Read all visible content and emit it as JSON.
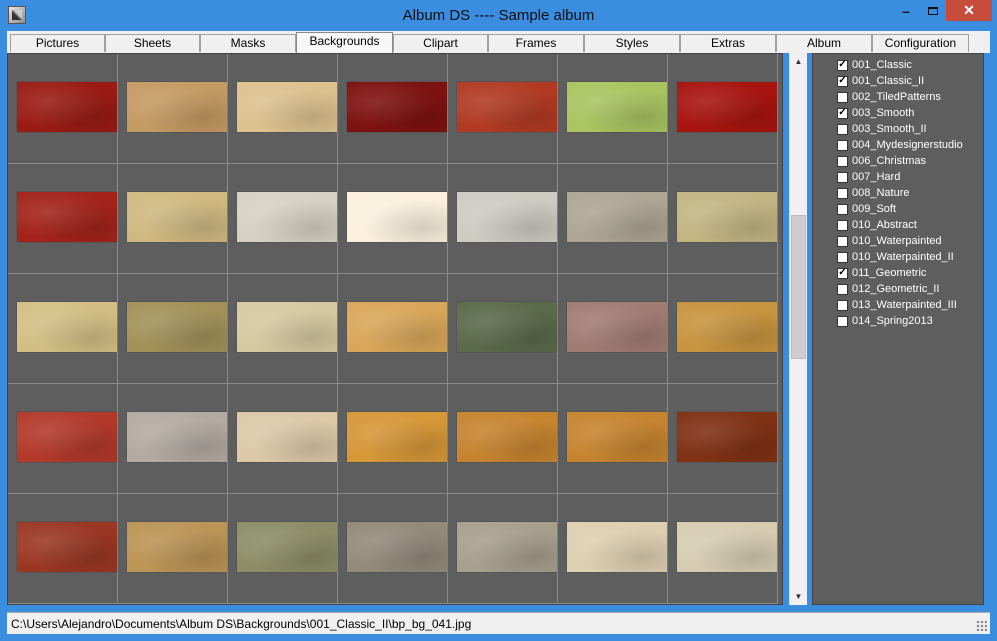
{
  "window": {
    "title": "Album DS  ----  Sample album"
  },
  "tabs": [
    {
      "label": "Pictures"
    },
    {
      "label": "Sheets"
    },
    {
      "label": "Masks"
    },
    {
      "label": "Backgrounds"
    },
    {
      "label": "Clipart"
    },
    {
      "label": "Frames"
    },
    {
      "label": "Styles"
    },
    {
      "label": "Extras"
    },
    {
      "label": "Album"
    },
    {
      "label": "Configuration"
    }
  ],
  "active_tab": "Backgrounds",
  "thumbnails": [
    [
      "#9a1b14",
      "#c49a63",
      "#dcc28e",
      "#7e1210",
      "#b23a23",
      "#a9c460",
      "#a8140f"
    ],
    [
      "#a3231a",
      "#d0b981",
      "#d5d2c3",
      "#faf0dc",
      "#cdcbc2",
      "#aea693",
      "#c3b582"
    ],
    [
      "#d3bf85",
      "#a39159",
      "#d6c9a1",
      "#d9a659",
      "#5b6a4a",
      "#a07c72",
      "#c7943f"
    ],
    [
      "#b3392a",
      "#b3aaa2",
      "#ddc8a8",
      "#d69737",
      "#c6842f",
      "#803113"
    ],
    [
      "#9a3723",
      "#bb9456",
      "#8c8d67",
      "#938a7a",
      "#a79f8e",
      "#ddcfb1",
      "#d6ccb2"
    ]
  ],
  "categories": [
    {
      "label": "001_Classic",
      "checked": true
    },
    {
      "label": "001_Classic_II",
      "checked": true
    },
    {
      "label": "002_TiledPatterns",
      "checked": false
    },
    {
      "label": "003_Smooth",
      "checked": true
    },
    {
      "label": "003_Smooth_II",
      "checked": false
    },
    {
      "label": "004_Mydesignerstudio",
      "checked": false
    },
    {
      "label": "006_Christmas",
      "checked": false
    },
    {
      "label": "007_Hard",
      "checked": false
    },
    {
      "label": "008_Nature",
      "checked": false
    },
    {
      "label": "009_Soft",
      "checked": false
    },
    {
      "label": "010_Abstract",
      "checked": false
    },
    {
      "label": "010_Waterpainted",
      "checked": false
    },
    {
      "label": "010_Waterpainted_II",
      "checked": false
    },
    {
      "label": "011_Geometric",
      "checked": true
    },
    {
      "label": "012_Geometric_II",
      "checked": false
    },
    {
      "label": "013_Waterpainted_III",
      "checked": false
    },
    {
      "label": "014_Spring2013",
      "checked": false
    }
  ],
  "status": {
    "path": "C:\\Users\\Alejandro\\Documents\\Album DS\\Backgrounds\\001_Classic_II\\bp_bg_041.jpg"
  },
  "icons": {
    "app": "album-app-icon",
    "minimize": "minimize-icon",
    "maximize": "maximize-icon",
    "close": "close-icon",
    "check": "checkmark-icon"
  }
}
